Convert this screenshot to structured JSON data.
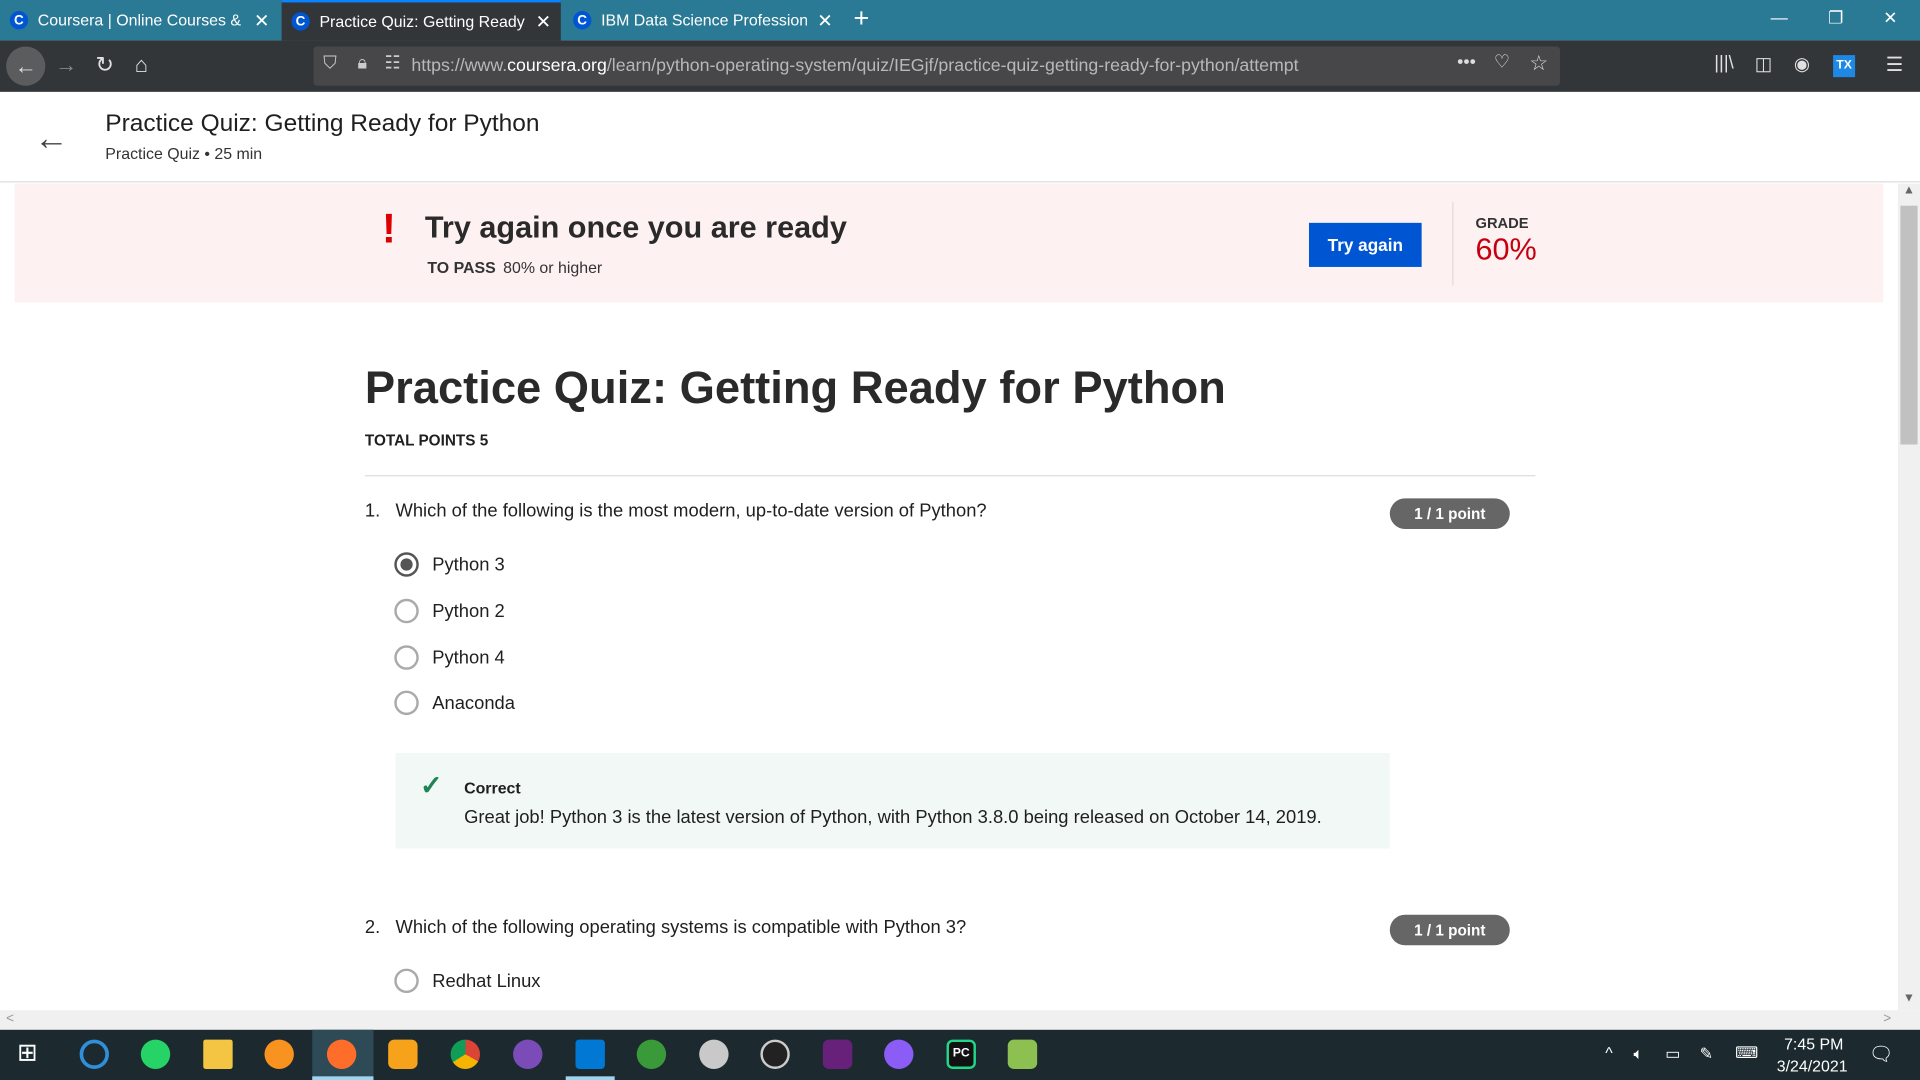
{
  "browser": {
    "tabs": [
      {
        "title": "Coursera | Online Courses & Credentials",
        "active": false
      },
      {
        "title": "Practice Quiz: Getting Ready for Python",
        "active": true
      },
      {
        "title": "IBM Data Science Professional Certificate",
        "active": false
      }
    ],
    "url_prefix": "https://www.",
    "url_domain": "coursera.org",
    "url_path": "/learn/python-operating-system/quiz/IEGjf/practice-quiz-getting-ready-for-python/attempt",
    "favicon_letter": "C"
  },
  "header": {
    "title": "Practice Quiz: Getting Ready for Python",
    "subtitle": "Practice Quiz • 25 min"
  },
  "banner": {
    "title": "Try again once you are ready",
    "pass_label": "TO PASS",
    "pass_value": "80% or higher",
    "button": "Try again",
    "grade_label": "GRADE",
    "grade_value": "60%",
    "grade_color": "#c6000e"
  },
  "quiz": {
    "title": "Practice Quiz: Getting Ready for Python",
    "total_points": "TOTAL POINTS 5",
    "questions": [
      {
        "number": "1.",
        "text": "Which of the following is the most modern, up-to-date version of Python?",
        "points": "1 / 1 point",
        "options": [
          {
            "label": "Python 3",
            "selected": true
          },
          {
            "label": "Python 2",
            "selected": false
          },
          {
            "label": "Python 4",
            "selected": false
          },
          {
            "label": "Anaconda",
            "selected": false
          }
        ],
        "feedback": {
          "label": "Correct",
          "text": "Great job! Python 3 is the latest version of Python, with Python 3.8.0 being released on October 14, 2019."
        }
      },
      {
        "number": "2.",
        "text": "Which of the following operating systems is compatible with Python 3?",
        "points": "1 / 1 point",
        "options": [
          {
            "label": "Redhat Linux",
            "selected": false
          }
        ]
      }
    ]
  },
  "taskbar": {
    "time": "7:45 PM",
    "date": "3/24/2021",
    "apps": [
      "windows-start",
      "origin",
      "whatsapp",
      "file-explorer",
      "brave",
      "firefox",
      "uc-browser",
      "chrome",
      "github-desktop",
      "vscode",
      "idm",
      "snipping-tool",
      "inkscape",
      "visual-studio",
      "messenger",
      "pycharm",
      "notepad-plus-plus"
    ]
  }
}
